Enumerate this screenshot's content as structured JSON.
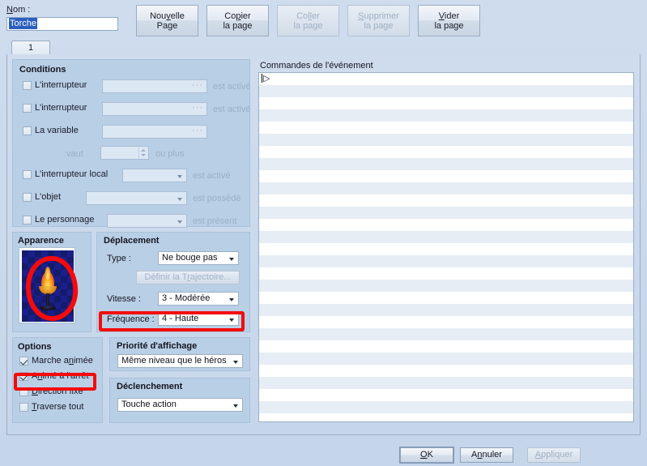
{
  "window": {
    "name_label": "Nom :",
    "name_value": "Torche"
  },
  "toolbar": {
    "new_page": {
      "line1": "Nouvelle",
      "line2": "Page"
    },
    "copy_page": {
      "line1": "Copier",
      "line2": "la page"
    },
    "paste_page": {
      "line1": "Coller",
      "line2": "la page"
    },
    "delete_page": {
      "line1": "Supprimer",
      "line2": "la page"
    },
    "clear_page": {
      "line1": "Vider",
      "line2": "la page"
    }
  },
  "tabs": [
    {
      "label": "1"
    }
  ],
  "conditions": {
    "title": "Conditions",
    "rows": [
      {
        "label": "L'interrupteur",
        "checked": false,
        "value": "",
        "suffix": "est activé"
      },
      {
        "label": "L'interrupteur",
        "checked": false,
        "value": "",
        "suffix": "est activé"
      },
      {
        "label": "La variable",
        "checked": false,
        "value": "",
        "suffix": ""
      }
    ],
    "variable_value_label": "vaut",
    "variable_value": "",
    "variable_suffix": "ou plus",
    "local_switch": {
      "label": "L'interrupteur local",
      "checked": false,
      "value": "",
      "suffix": "est activé"
    },
    "item": {
      "label": "L'objet",
      "checked": false,
      "value": "",
      "suffix": "est possédé"
    },
    "actor": {
      "label": "Le personnage",
      "checked": false,
      "value": "",
      "suffix": "est présent"
    }
  },
  "apparence": {
    "title": "Apparence",
    "sprite_name": "torch-sprite"
  },
  "deplacement": {
    "title": "Déplacement",
    "type_label": "Type :",
    "type_value": "Ne bouge pas",
    "route_button": "Définir la Trajectoire...",
    "speed_label": "Vitesse :",
    "speed_value": "3 - Modérée",
    "frequency_label": "Fréquence :",
    "frequency_value": "4 - Haute"
  },
  "options": {
    "title": "Options",
    "items": [
      {
        "label": "Marche animée",
        "checked": true
      },
      {
        "label": "Animé à l'arrêt",
        "checked": true
      },
      {
        "label": "Direction fixe",
        "checked": false
      },
      {
        "label": "Traverse tout",
        "checked": false
      }
    ]
  },
  "priorite": {
    "title": "Priorité d'affichage",
    "value": "Même niveau que le héros"
  },
  "declenchement": {
    "title": "Déclenchement",
    "value": "Touche action"
  },
  "commandes": {
    "title": "Commandes de l'événement",
    "rows": [
      "▷"
    ],
    "total_rows": 29
  },
  "footer": {
    "ok": "OK",
    "cancel": "Annuler",
    "apply": "Appliquer"
  },
  "annotations": {
    "accent_color": "#f40b0b",
    "marks": [
      {
        "name": "apparence-sprite-circle"
      },
      {
        "name": "frequence-box"
      },
      {
        "name": "anime-a-l-arret-box"
      }
    ]
  }
}
